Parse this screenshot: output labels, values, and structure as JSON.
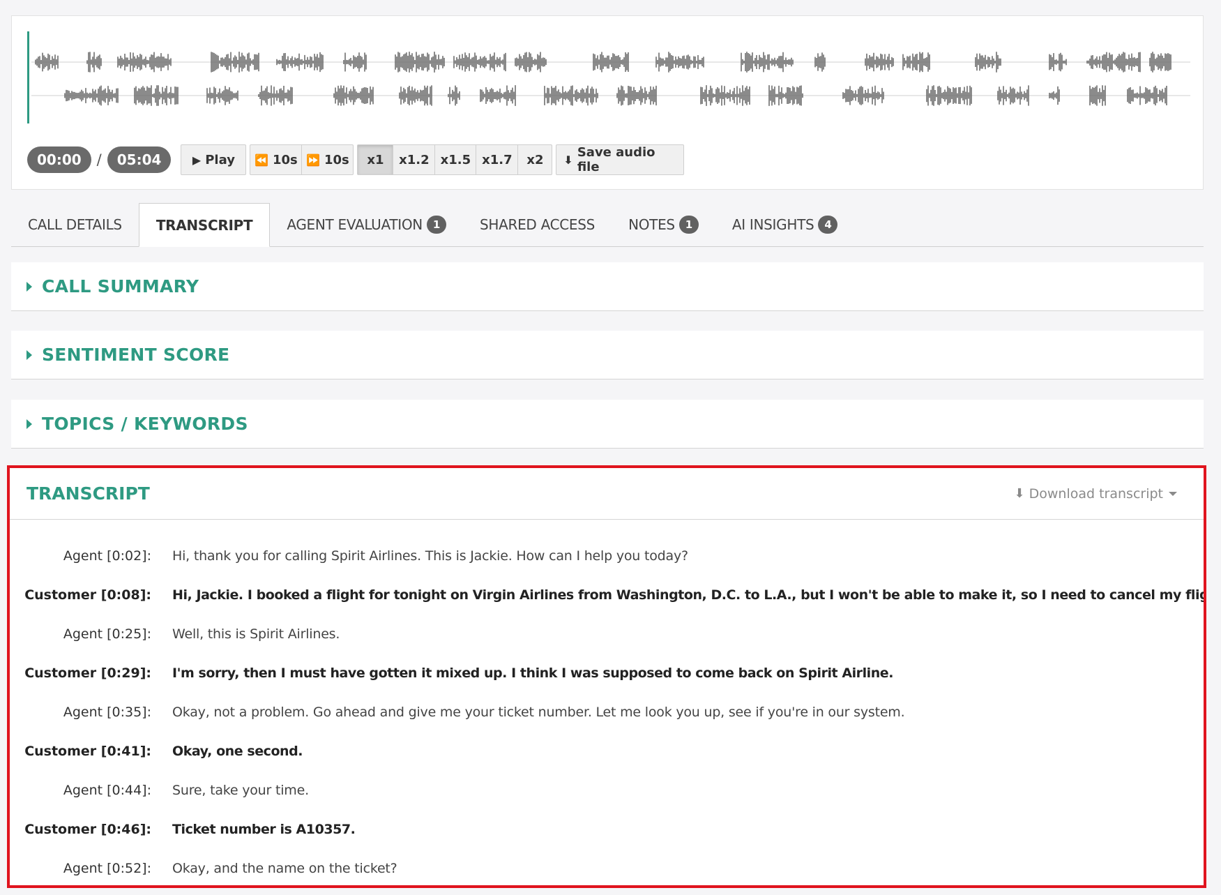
{
  "player": {
    "current_time": "00:00",
    "separator": "/",
    "duration": "05:04",
    "play_label": "Play",
    "rewind_label": "10s",
    "forward_label": "10s",
    "speeds": [
      {
        "label": "x1",
        "active": true
      },
      {
        "label": "x1.2",
        "active": false
      },
      {
        "label": "x1.5",
        "active": false
      },
      {
        "label": "x1.7",
        "active": false
      },
      {
        "label": "x2",
        "active": false
      }
    ],
    "save_label": "Save audio file"
  },
  "tabs": [
    {
      "label": "CALL DETAILS",
      "active": false,
      "badge": null
    },
    {
      "label": "TRANSCRIPT",
      "active": true,
      "badge": null
    },
    {
      "label": "AGENT EVALUATION",
      "active": false,
      "badge": "1"
    },
    {
      "label": "SHARED ACCESS",
      "active": false,
      "badge": null
    },
    {
      "label": "NOTES",
      "active": false,
      "badge": "1"
    },
    {
      "label": "AI INSIGHTS",
      "active": false,
      "badge": "4"
    }
  ],
  "sections": {
    "call_summary": "CALL SUMMARY",
    "sentiment_score": "SENTIMENT SCORE",
    "topics_keywords": "TOPICS / KEYWORDS"
  },
  "transcript": {
    "title": "TRANSCRIPT",
    "download_label": "Download transcript",
    "lines": [
      {
        "role": "agent",
        "speaker": "Agent [0:02]:",
        "text": "Hi, thank you for calling Spirit Airlines. This is Jackie. How can I help you today?"
      },
      {
        "role": "customer",
        "speaker": "Customer [0:08]:",
        "text": "Hi, Jackie. I booked a flight for tonight on Virgin Airlines from Washington, D.C. to L.A., but I won't be able to make it, so I need to cancel my flight."
      },
      {
        "role": "agent",
        "speaker": "Agent [0:25]:",
        "text": "Well, this is Spirit Airlines."
      },
      {
        "role": "customer",
        "speaker": "Customer [0:29]:",
        "text": "I'm sorry, then I must have gotten it mixed up. I think I was supposed to come back on Spirit Airline."
      },
      {
        "role": "agent",
        "speaker": "Agent [0:35]:",
        "text": "Okay, not a problem. Go ahead and give me your ticket number. Let me look you up, see if you're in our system."
      },
      {
        "role": "customer",
        "speaker": "Customer [0:41]:",
        "text": "Okay, one second."
      },
      {
        "role": "agent",
        "speaker": "Agent [0:44]:",
        "text": "Sure, take your time."
      },
      {
        "role": "customer",
        "speaker": "Customer [0:46]:",
        "text": "Ticket number is A10357."
      },
      {
        "role": "agent",
        "speaker": "Agent [0:52]:",
        "text": "Okay, and the name on the ticket?"
      }
    ]
  },
  "colors": {
    "accent": "#2e9a82",
    "highlight_border": "#e0141e",
    "waveform": "#6e6e6e",
    "playhead": "#2e9a82"
  }
}
